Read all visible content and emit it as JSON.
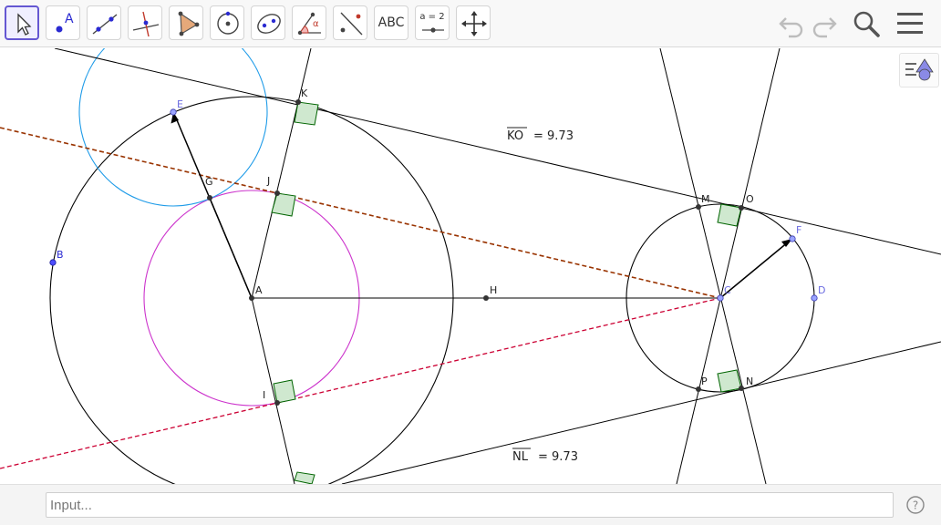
{
  "toolbar": {
    "tools": [
      {
        "name": "move-tool",
        "label": ""
      },
      {
        "name": "point-tool",
        "label": "A"
      },
      {
        "name": "line-tool",
        "label": ""
      },
      {
        "name": "perpendicular-line-tool",
        "label": ""
      },
      {
        "name": "polygon-tool",
        "label": ""
      },
      {
        "name": "circle-center-point-tool",
        "label": ""
      },
      {
        "name": "ellipse-tool",
        "label": ""
      },
      {
        "name": "angle-tool",
        "label": "α"
      },
      {
        "name": "reflect-tool",
        "label": ""
      },
      {
        "name": "text-tool",
        "label": "ABC"
      },
      {
        "name": "slider-tool",
        "label": "a = 2"
      },
      {
        "name": "move-graphics-view-tool",
        "label": ""
      }
    ],
    "selected_tool": "move-tool",
    "right_icons": [
      "undo-icon",
      "redo-icon",
      "search-icon",
      "menu-icon"
    ]
  },
  "construction": {
    "point_labels": {
      "A": "A",
      "B": "B",
      "C": "C",
      "D": "D",
      "E": "E",
      "F": "F",
      "G": "G",
      "H": "H",
      "I": "I",
      "J": "J",
      "K": "K",
      "M": "M",
      "N": "N",
      "O": "O",
      "P": "P"
    },
    "measurements": {
      "ko_name": "KO",
      "ko_value": "= 9.73",
      "nl_name": "NL",
      "nl_value": "= 9.73"
    },
    "colors": {
      "free_point": "#4d4dff",
      "dependent_point": "#333333",
      "line": "#000000",
      "dashed_brown": "#993300",
      "dashed_red": "#cc0033",
      "circle_blue": "#1e9be8",
      "circle_magenta": "#cc33cc",
      "right_angle_fill": "#cfe8cf",
      "right_angle_stroke": "#006400"
    }
  },
  "style_bar": {
    "icon": "graphics-style-icon"
  },
  "input_bar": {
    "value": "",
    "placeholder": "Input...",
    "help_icon": "help-icon"
  }
}
